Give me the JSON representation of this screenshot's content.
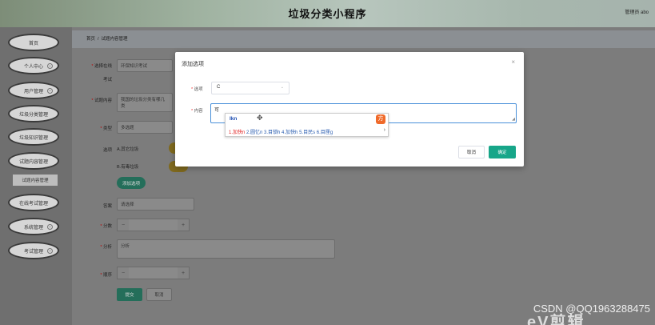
{
  "header": {
    "title": "垃圾分类小程序",
    "admin": "管理员 abo"
  },
  "sidebar": {
    "items": [
      {
        "label": "首页"
      },
      {
        "label": "个人中心"
      },
      {
        "label": "用户管理"
      },
      {
        "label": "垃圾分类管理"
      },
      {
        "label": "垃圾知识管理"
      },
      {
        "label": "试题内容管理"
      },
      {
        "label": "在线考试管理"
      },
      {
        "label": "系统管理"
      },
      {
        "label": "考试管理"
      }
    ],
    "subitem": "试题内容管理"
  },
  "breadcrumb": {
    "home": "首页",
    "sep": "/",
    "current": "试题内容管理"
  },
  "form": {
    "select_exam_label": "选择在线",
    "select_exam_label2": "考试",
    "select_exam_value": "环保知识考试",
    "question_label": "试题内容",
    "question_value": "我国的垃圾分类有哪几类",
    "type_label": "类型",
    "type_value": "多选题",
    "options_label": "选项",
    "option_a": "A.其它垃圾",
    "option_b": "B.有毒垃圾",
    "add_option": "添加选项",
    "answer_label": "答案",
    "answer_placeholder": "请选择",
    "score_label": "分数",
    "analysis_label": "分析",
    "analysis_placeholder": "分析",
    "order_label": "顺序",
    "submit": "提交",
    "cancel": "取消"
  },
  "dialog": {
    "title": "添加选项",
    "close": "×",
    "option_label": "选项",
    "option_value": "C",
    "content_label": "内容",
    "content_value": "可",
    "cancel": "取消",
    "confirm": "确定"
  },
  "ime": {
    "composition": "lkn",
    "candidates": [
      "1.加快n",
      "2.圆忆n",
      "3.目锁h",
      "4.加快h",
      "5.目民s",
      "6.目厘g"
    ],
    "logo": "方"
  },
  "watermark": {
    "csdn": "CSDN @QQ1963288475",
    "ev": "eV剪辑"
  },
  "colors": {
    "accent": "#17a689",
    "dialog_border": "#4a90d9"
  }
}
